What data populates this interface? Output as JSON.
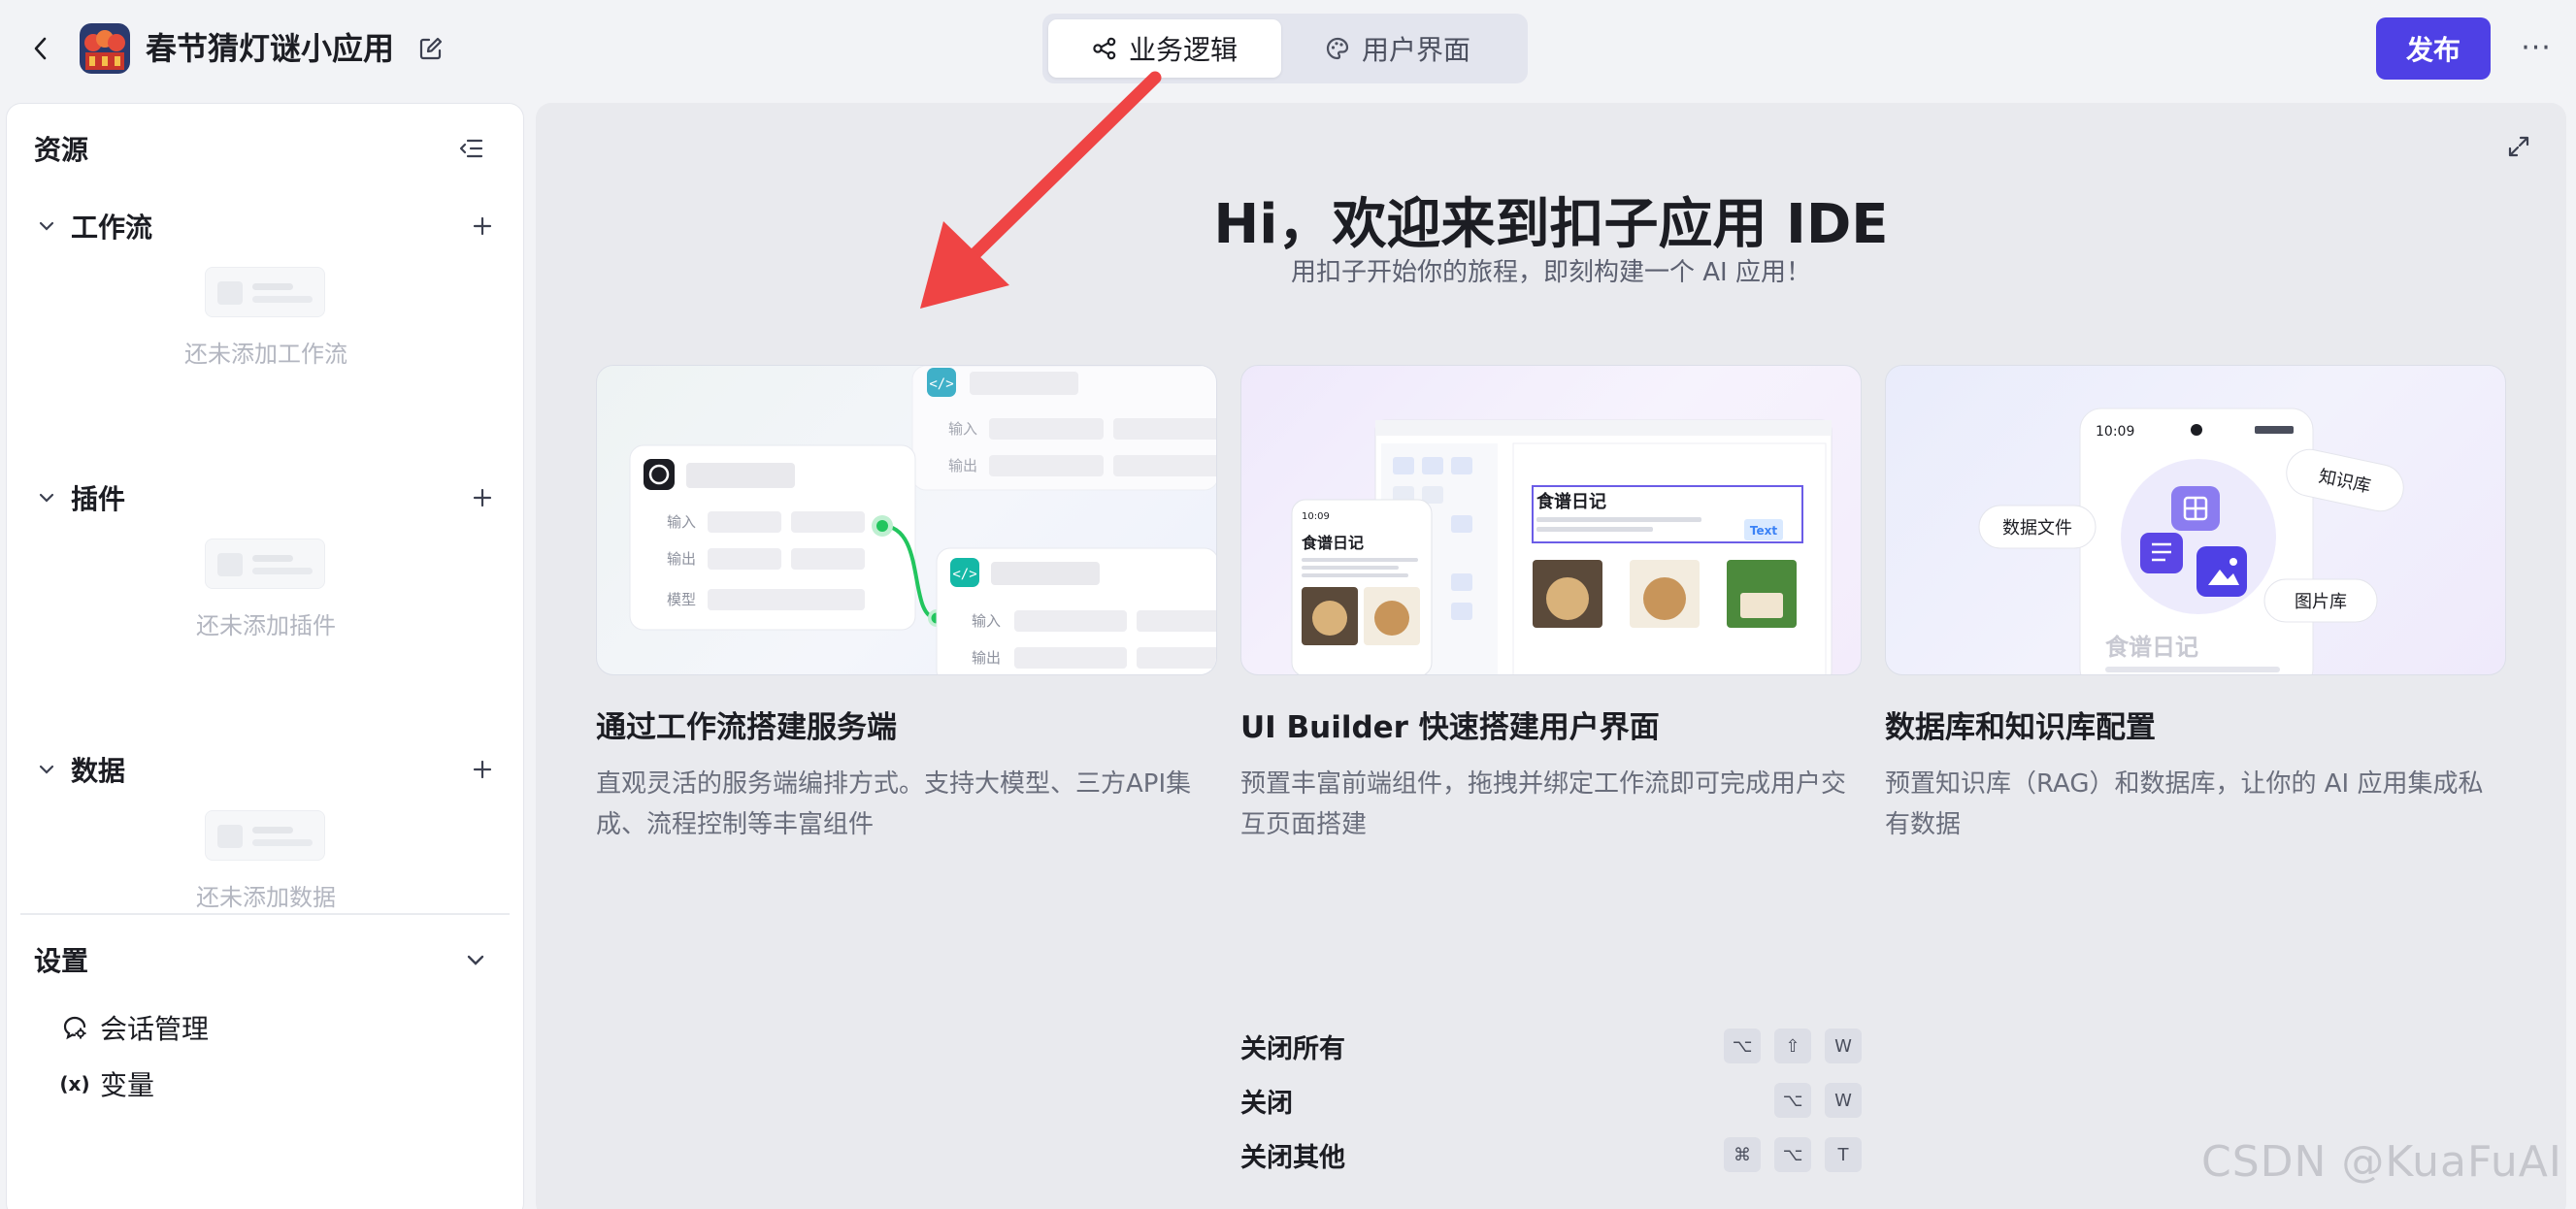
{
  "app": {
    "title": "春节猜灯谜小应用"
  },
  "tabs": [
    {
      "label": "业务逻辑",
      "active": true
    },
    {
      "label": "用户界面",
      "active": false
    }
  ],
  "actions": {
    "publish": "发布",
    "more": "···"
  },
  "sidebar": {
    "title": "资源",
    "sections": [
      {
        "title": "工作流",
        "empty": "还未添加工作流"
      },
      {
        "title": "插件",
        "empty": "还未添加插件"
      },
      {
        "title": "数据",
        "empty": "还未添加数据"
      }
    ],
    "settings": {
      "title": "设置",
      "items": [
        {
          "label": "会话管理",
          "icon": "chat-settings-icon"
        },
        {
          "label": "变量",
          "icon": "(x)"
        }
      ]
    }
  },
  "hero": {
    "title": "Hi，欢迎来到扣子应用 IDE",
    "subtitle": "用扣子开始你的旅程，即刻构建一个 AI 应用！"
  },
  "cards": [
    {
      "title": "通过工作流搭建服务端",
      "desc": "直观灵活的服务端编排方式。支持大模型、三方API集成、流程控制等丰富组件",
      "illus": {
        "in": "输入",
        "out": "输出",
        "model": "模型"
      }
    },
    {
      "title": "UI Builder 快速搭建用户界面",
      "desc": "预置丰富前端组件，拖拽并绑定工作流即可完成用户交互页面搭建",
      "illus": {
        "recipe": "食谱日记",
        "text_tag": "Text",
        "time": "10:09"
      }
    },
    {
      "title": "数据库和知识库配置",
      "desc": "预置知识库（RAG）和数据库，让你的 AI 应用集成私有数据",
      "illus": {
        "time": "10:09",
        "files": "数据文件",
        "kb": "知识库",
        "gallery": "图片库",
        "recipe": "食谱日记"
      }
    }
  ],
  "shortcuts": [
    {
      "label": "关闭所有",
      "keys": [
        "⌥",
        "⇧",
        "W"
      ]
    },
    {
      "label": "关闭",
      "keys": [
        "⌥",
        "W"
      ]
    },
    {
      "label": "关闭其他",
      "keys": [
        "⌘",
        "⌥",
        "T"
      ]
    }
  ],
  "watermark": "CSDN @KuaFuAI",
  "colors": {
    "accent": "#4e40e5",
    "arrow": "#ef4444",
    "workflow_green": "#22c55e"
  }
}
